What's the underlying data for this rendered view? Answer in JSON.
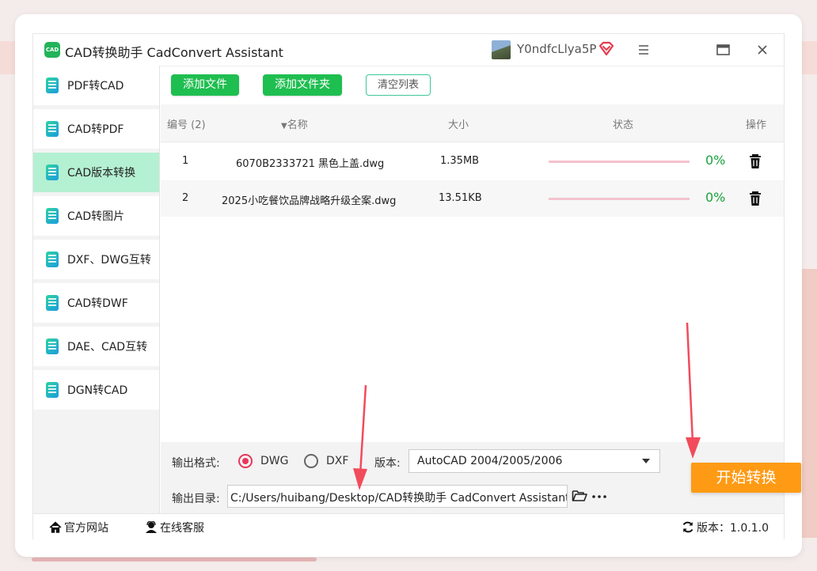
{
  "app": {
    "title": "CAD转换助手 CadConvert Assistant",
    "logo_text": "CAD",
    "user_name": "Y0ndfcLlya5P"
  },
  "sidebar": {
    "items": [
      {
        "label": "PDF转CAD",
        "active": false
      },
      {
        "label": "CAD转PDF",
        "active": false
      },
      {
        "label": "CAD版本转换",
        "active": true
      },
      {
        "label": "CAD转图片",
        "active": false
      },
      {
        "label": "DXF、DWG互转",
        "active": false
      },
      {
        "label": "CAD转DWF",
        "active": false
      },
      {
        "label": "DAE、CAD互转",
        "active": false
      },
      {
        "label": "DGN转CAD",
        "active": false
      }
    ]
  },
  "toolbar": {
    "add_file": "添加文件",
    "add_folder": "添加文件夹",
    "clear_list": "清空列表"
  },
  "table": {
    "headers": {
      "index": "编号 (2)",
      "name": "名称",
      "size": "大小",
      "status": "状态",
      "action": "操作"
    },
    "rows": [
      {
        "index": "1",
        "name": "6070B2333721 黑色上盖.dwg",
        "size": "1.35MB",
        "progress": 0,
        "percent": "0%"
      },
      {
        "index": "2",
        "name": "2025小吃餐饮品牌战略升级全案.dwg",
        "size": "13.51KB",
        "progress": 0,
        "percent": "0%"
      }
    ]
  },
  "output": {
    "format_label": "输出格式:",
    "format_options": [
      {
        "label": "DWG",
        "selected": true
      },
      {
        "label": "DXF",
        "selected": false
      }
    ],
    "version_label": "版本:",
    "version_value": "AutoCAD 2004/2005/2006",
    "dir_label": "输出目录:",
    "dir_value": "C:/Users/huibang/Desktop/CAD转换助手 CadConvert Assistant",
    "start_button": "开始转换"
  },
  "footer": {
    "website": "官方网站",
    "support": "在线客服",
    "version_text": "版本：1.0.1.0"
  },
  "colors": {
    "accent_green": "#1fbe50",
    "active_nav": "#b4f0d2",
    "start_orange": "#ff9a14",
    "progress_track": "#f4c2cf",
    "percent_green": "#19a33d",
    "annotation_red": "#f24b5b"
  }
}
